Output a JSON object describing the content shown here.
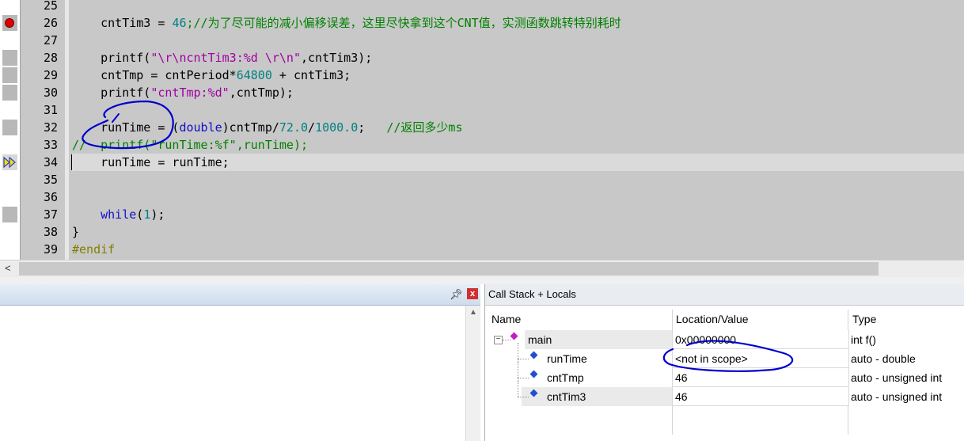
{
  "editor": {
    "lines": [
      {
        "num": "25",
        "tokens": []
      },
      {
        "num": "26",
        "tokens": [
          {
            "t": "    cntTim3 = ",
            "c": ""
          },
          {
            "t": "46",
            "c": "num"
          },
          {
            "t": ";//为了尽可能的减小偏移误差，这里尽快拿到这个CNT值，实测函数跳转特别耗时",
            "c": "cmt"
          }
        ]
      },
      {
        "num": "27",
        "tokens": []
      },
      {
        "num": "28",
        "tokens": [
          {
            "t": "    printf(",
            "c": ""
          },
          {
            "t": "\"\\r\\ncntTim3:%d \\r\\n\"",
            "c": "str"
          },
          {
            "t": ",cntTim3);",
            "c": ""
          }
        ]
      },
      {
        "num": "29",
        "tokens": [
          {
            "t": "    cntTmp = cntPeriod*",
            "c": ""
          },
          {
            "t": "64800",
            "c": "num"
          },
          {
            "t": " + cntTim3;",
            "c": ""
          }
        ]
      },
      {
        "num": "30",
        "tokens": [
          {
            "t": "    printf(",
            "c": ""
          },
          {
            "t": "\"cntTmp:%d\"",
            "c": "str"
          },
          {
            "t": ",cntTmp);",
            "c": ""
          }
        ]
      },
      {
        "num": "31",
        "tokens": []
      },
      {
        "num": "32",
        "tokens": [
          {
            "t": "    runTime = (",
            "c": ""
          },
          {
            "t": "double",
            "c": "kw"
          },
          {
            "t": ")cntTmp/",
            "c": ""
          },
          {
            "t": "72.0",
            "c": "num"
          },
          {
            "t": "/",
            "c": ""
          },
          {
            "t": "1000.0",
            "c": "num"
          },
          {
            "t": ";   ",
            "c": ""
          },
          {
            "t": "//返回多少ms",
            "c": "cmt"
          }
        ]
      },
      {
        "num": "33",
        "tokens": [
          {
            "t": "//  printf(\"runTime:%f\",runTime);",
            "c": "cmt"
          }
        ]
      },
      {
        "num": "34",
        "tokens": [
          {
            "t": "    runTime = runTime;",
            "c": ""
          }
        ]
      },
      {
        "num": "35",
        "tokens": []
      },
      {
        "num": "36",
        "tokens": []
      },
      {
        "num": "37",
        "tokens": [
          {
            "t": "    ",
            "c": ""
          },
          {
            "t": "while",
            "c": "kw"
          },
          {
            "t": "(",
            "c": ""
          },
          {
            "t": "1",
            "c": "num"
          },
          {
            "t": ");",
            "c": ""
          }
        ]
      },
      {
        "num": "38",
        "tokens": [
          {
            "t": "}",
            "c": ""
          }
        ]
      },
      {
        "num": "39",
        "tokens": [
          {
            "t": "#endif",
            "c": "pp"
          }
        ]
      }
    ],
    "breakpoint_line": "26",
    "current_line": "34",
    "scroll_left_icon": "chevron-left-icon"
  },
  "colors": {
    "keyword": "#1010c8",
    "number": "#008080",
    "string": "#a000a0",
    "comment": "#008000",
    "preprocessor": "#808000",
    "annotation_ink": "#0000cc"
  },
  "left_panel": {
    "pin_icon": "pin-icon",
    "close_icon": "close-icon",
    "close_glyph": "x"
  },
  "call_stack": {
    "title": "Call Stack + Locals",
    "columns": [
      "Name",
      "Location/Value",
      "Type"
    ],
    "rows": [
      {
        "name": "main",
        "value": "0x00000000",
        "type": "int f()",
        "level": 0,
        "icon": "function-icon"
      },
      {
        "name": "runTime",
        "value": "<not in scope>",
        "type": "auto - double",
        "level": 1,
        "icon": "variable-icon"
      },
      {
        "name": "cntTmp",
        "value": "46",
        "type": "auto - unsigned int",
        "level": 1,
        "icon": "variable-icon"
      },
      {
        "name": "cntTim3",
        "value": "46",
        "type": "auto - unsigned int",
        "level": 1,
        "icon": "variable-icon"
      }
    ],
    "expand_glyph": "−"
  }
}
